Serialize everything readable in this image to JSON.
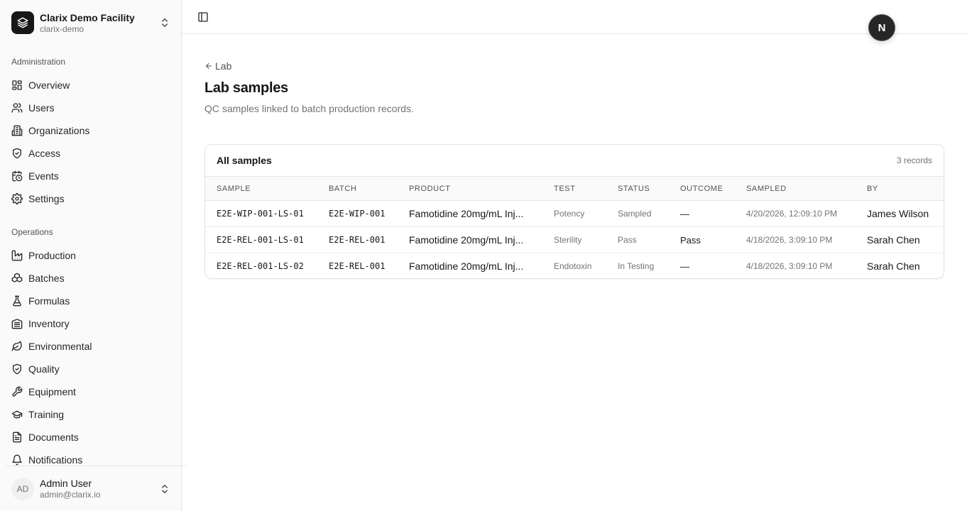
{
  "org": {
    "name": "Clarix Demo Facility",
    "slug": "clarix-demo"
  },
  "nav": {
    "administration_label": "Administration",
    "administration": [
      {
        "label": "Overview",
        "icon": "grid-icon"
      },
      {
        "label": "Users",
        "icon": "users-icon"
      },
      {
        "label": "Organizations",
        "icon": "building-icon"
      },
      {
        "label": "Access",
        "icon": "shield-check-icon"
      },
      {
        "label": "Events",
        "icon": "calendar-clock-icon"
      },
      {
        "label": "Settings",
        "icon": "gear-icon"
      }
    ],
    "operations_label": "Operations",
    "operations": [
      {
        "label": "Production",
        "icon": "factory-icon"
      },
      {
        "label": "Batches",
        "icon": "boxes-icon"
      },
      {
        "label": "Formulas",
        "icon": "flask-icon"
      },
      {
        "label": "Inventory",
        "icon": "warehouse-icon"
      },
      {
        "label": "Environmental",
        "icon": "leaf-icon"
      },
      {
        "label": "Quality",
        "icon": "shield-check-icon"
      },
      {
        "label": "Equipment",
        "icon": "wrench-icon"
      },
      {
        "label": "Training",
        "icon": "graduation-cap-icon"
      },
      {
        "label": "Documents",
        "icon": "file-text-icon"
      },
      {
        "label": "Notifications",
        "icon": "bell-icon"
      }
    ]
  },
  "user": {
    "initials": "AD",
    "name": "Admin User",
    "email": "admin@clarix.io"
  },
  "header": {
    "badge": "N"
  },
  "page": {
    "back_label": "Lab",
    "title": "Lab samples",
    "description": "QC samples linked to batch production records."
  },
  "table": {
    "title": "All samples",
    "count": "3 records",
    "columns": [
      "SAMPLE",
      "BATCH",
      "PRODUCT",
      "TEST",
      "STATUS",
      "OUTCOME",
      "SAMPLED",
      "BY"
    ],
    "rows": [
      {
        "sample": "E2E-WIP-001-LS-01",
        "batch": "E2E-WIP-001",
        "product": "Famotidine 20mg/mL Inj...",
        "test": "Potency",
        "status": "Sampled",
        "outcome": "—",
        "sampled": "4/20/2026, 12:09:10 PM",
        "by": "James Wilson"
      },
      {
        "sample": "E2E-REL-001-LS-01",
        "batch": "E2E-REL-001",
        "product": "Famotidine 20mg/mL Inj...",
        "test": "Sterility",
        "status": "Pass",
        "outcome": "Pass",
        "sampled": "4/18/2026, 3:09:10 PM",
        "by": "Sarah Chen"
      },
      {
        "sample": "E2E-REL-001-LS-02",
        "batch": "E2E-REL-001",
        "product": "Famotidine 20mg/mL Inj...",
        "test": "Endotoxin",
        "status": "In Testing",
        "outcome": "—",
        "sampled": "4/18/2026, 3:09:10 PM",
        "by": "Sarah Chen"
      }
    ]
  }
}
